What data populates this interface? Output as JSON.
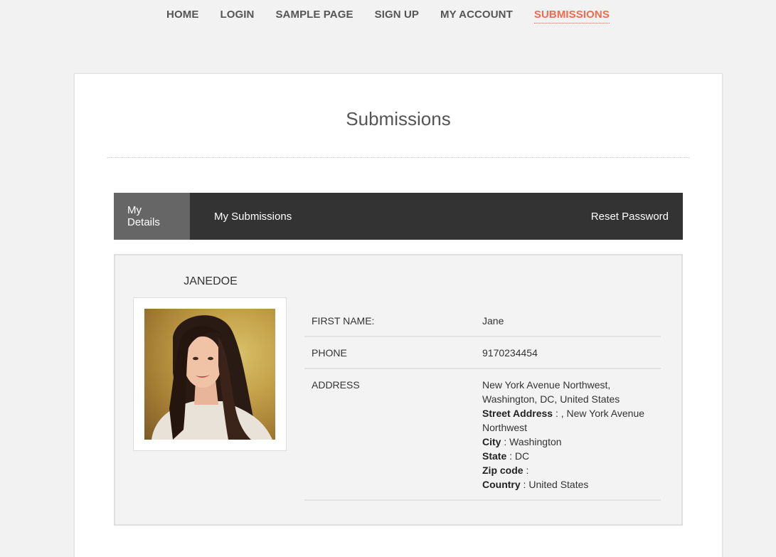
{
  "nav": {
    "items": [
      {
        "label": "HOME",
        "active": false
      },
      {
        "label": "LOGIN",
        "active": false
      },
      {
        "label": "SAMPLE PAGE",
        "active": false
      },
      {
        "label": "SIGN UP",
        "active": false
      },
      {
        "label": "MY ACCOUNT",
        "active": false
      },
      {
        "label": "SUBMISSIONS",
        "active": true
      }
    ],
    "active_color": "#f06a4e"
  },
  "page": {
    "title": "Submissions"
  },
  "tabs": {
    "my_details": "My Details",
    "my_submissions": "My Submissions",
    "reset_password": "Reset Password"
  },
  "profile": {
    "username": "JANEDOE",
    "avatar_icon": "user-photo",
    "fields": {
      "first_name": {
        "label": "FIRST NAME:",
        "value": "Jane"
      },
      "phone": {
        "label": "PHONE",
        "value": "9170234454"
      },
      "address": {
        "label": "ADDRESS",
        "full_line1": "New York Avenue Northwest,",
        "full_line2": "Washington, DC, United States",
        "street_label": "Street Address",
        "street_value": " : , New York Avenue Northwest",
        "city_label": "City",
        "city_value": " : Washington",
        "state_label": "State",
        "state_value": " : DC",
        "zip_label": "Zip code",
        "zip_value": " :",
        "country_label": "Country",
        "country_value": " : United States"
      }
    }
  }
}
